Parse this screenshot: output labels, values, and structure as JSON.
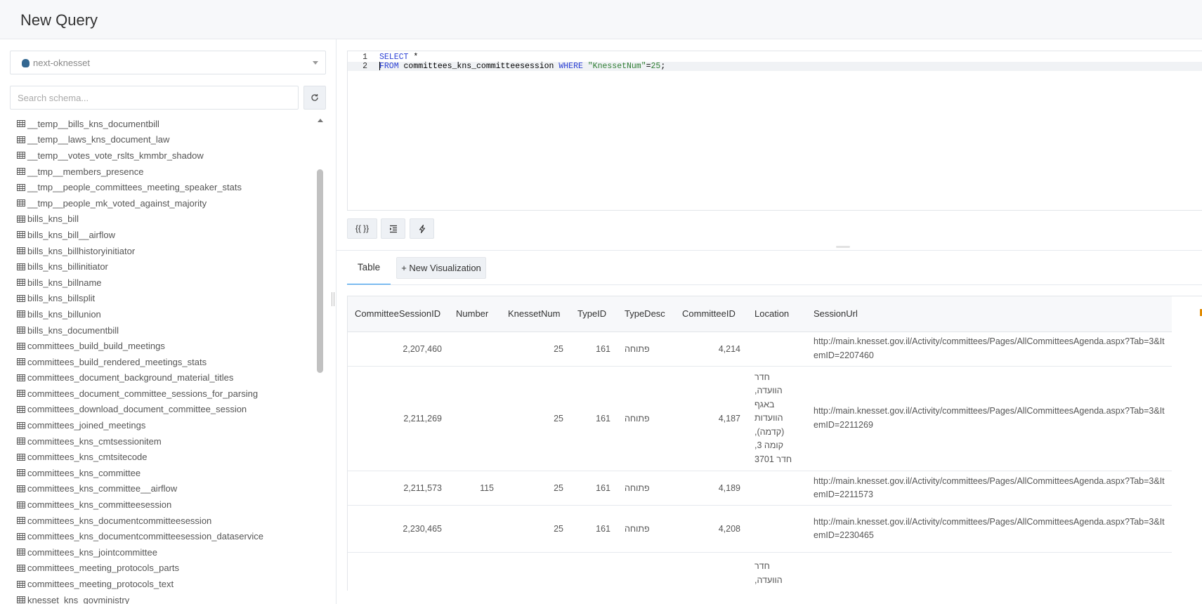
{
  "header": {
    "title": "New Query"
  },
  "datasource": {
    "name": "next-oknesset"
  },
  "schema": {
    "search_placeholder": "Search schema...",
    "tables": [
      "__temp__bills_kns_documentbill",
      "__temp__laws_kns_document_law",
      "__temp__votes_vote_rslts_kmmbr_shadow",
      "__tmp__members_presence",
      "__tmp__people_committees_meeting_speaker_stats",
      "__tmp__people_mk_voted_against_majority",
      "bills_kns_bill",
      "bills_kns_bill__airflow",
      "bills_kns_billhistoryinitiator",
      "bills_kns_billinitiator",
      "bills_kns_billname",
      "bills_kns_billsplit",
      "bills_kns_billunion",
      "bills_kns_documentbill",
      "committees_build_build_meetings",
      "committees_build_rendered_meetings_stats",
      "committees_document_background_material_titles",
      "committees_document_committee_sessions_for_parsing",
      "committees_download_document_committee_session",
      "committees_joined_meetings",
      "committees_kns_cmtsessionitem",
      "committees_kns_cmtsitecode",
      "committees_kns_committee",
      "committees_kns_committee__airflow",
      "committees_kns_committeesession",
      "committees_kns_documentcommitteesession",
      "committees_kns_documentcommitteesession_dataservice",
      "committees_kns_jointcommittee",
      "committees_meeting_protocols_parts",
      "committees_meeting_protocols_text",
      "knesset_kns_govministry"
    ]
  },
  "editor": {
    "line_numbers": [
      "1",
      "2"
    ],
    "line1": {
      "kw1": "SELECT",
      "rest": " *"
    },
    "line2": {
      "kw1": "FROM",
      "table": " committees_kns_committeesession ",
      "kw2": "WHERE",
      "sp": " ",
      "col": "\"KnessetNum\"",
      "op": "=",
      "val": "25",
      "end": ";"
    },
    "buttons": {
      "format": "{{ }}",
      "indent": "indent-icon",
      "execute": "bolt-icon"
    }
  },
  "results": {
    "tabs": {
      "table": "Table",
      "new_viz": "+ New Visualization"
    },
    "columns": [
      "CommitteeSessionID",
      "Number",
      "KnessetNum",
      "TypeID",
      "TypeDesc",
      "CommitteeID",
      "Location",
      "SessionUrl"
    ],
    "rows": [
      {
        "id": "2,207,460",
        "number": "",
        "knesset": "25",
        "type_id": "161",
        "type_desc": "פתוחה",
        "committee_id": "4,214",
        "location": "",
        "url": "http://main.knesset.gov.il/Activity/committees/Pages/AllCommitteesAgenda.aspx?Tab=3&ItemID=2207460"
      },
      {
        "id": "2,211,269",
        "number": "",
        "knesset": "25",
        "type_id": "161",
        "type_desc": "פתוחה",
        "committee_id": "4,187",
        "location": "חדר הוועדה, באגף הוועדות (קדמה), קומה 3, חדר 3701",
        "url": "http://main.knesset.gov.il/Activity/committees/Pages/AllCommitteesAgenda.aspx?Tab=3&ItemID=2211269"
      },
      {
        "id": "2,211,573",
        "number": "115",
        "knesset": "25",
        "type_id": "161",
        "type_desc": "פתוחה",
        "committee_id": "4,189",
        "location": "",
        "url": "http://main.knesset.gov.il/Activity/committees/Pages/AllCommitteesAgenda.aspx?Tab=3&ItemID=2211573"
      },
      {
        "id": "2,230,465",
        "number": "",
        "knesset": "25",
        "type_id": "161",
        "type_desc": "פתוחה",
        "committee_id": "4,208",
        "location": "",
        "url": "http://main.knesset.gov.il/Activity/committees/Pages/AllCommitteesAgenda.aspx?Tab=3&ItemID=2230465"
      },
      {
        "id": "",
        "number": "",
        "knesset": "",
        "type_id": "",
        "type_desc": "",
        "committee_id": "",
        "location": "חדר הוועדה,",
        "url": ""
      }
    ]
  }
}
